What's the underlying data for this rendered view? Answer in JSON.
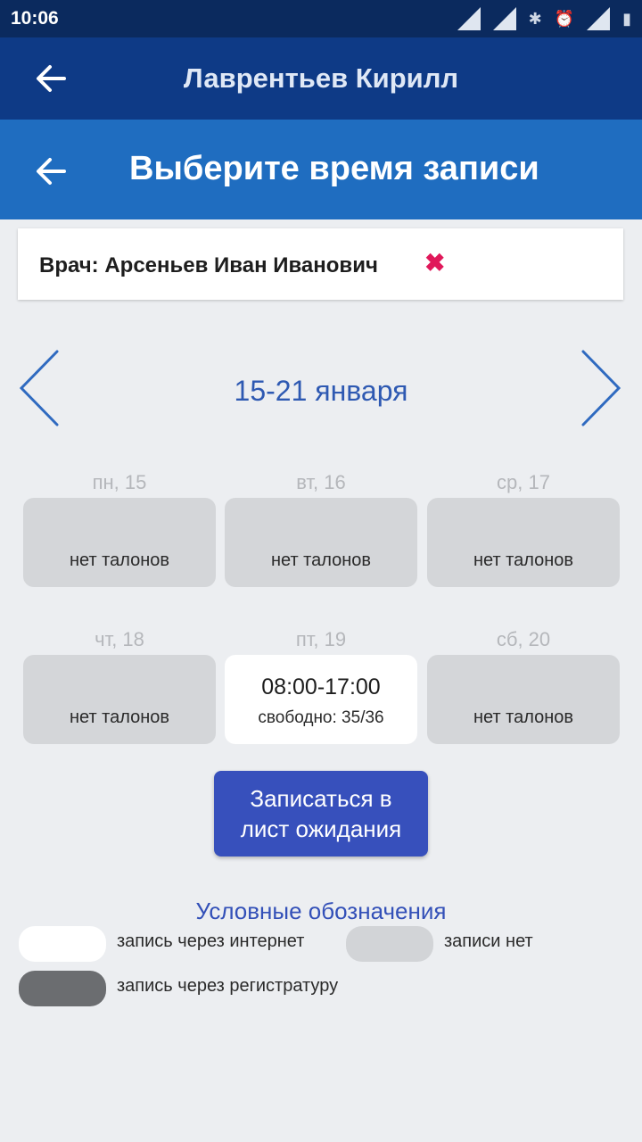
{
  "status_bar": {
    "time": "10:06"
  },
  "header": {
    "patient_name": "Лаврентьев Кирилл"
  },
  "subheader": {
    "title": "Выберите время записи"
  },
  "doctor": {
    "label": "Врач: Арсеньев Иван Иванович",
    "remove_glyph": "✖"
  },
  "week": {
    "label": "15-21 января"
  },
  "days": [
    {
      "label": "пн, 15",
      "status": "нет талонов"
    },
    {
      "label": "вт, 16",
      "status": "нет талонов"
    },
    {
      "label": "ср, 17",
      "status": "нет талонов"
    },
    {
      "label": "чт, 18",
      "status": "нет талонов"
    },
    {
      "label": "пт, 19",
      "time": "08:00-17:00",
      "free": "свободно: 35/36"
    },
    {
      "label": "сб, 20",
      "status": "нет талонов"
    }
  ],
  "waitlist_button": {
    "label": "Записаться в лист ожидания"
  },
  "legend": {
    "title": "Условные обозначения",
    "items": [
      {
        "text": "запись через интернет",
        "color": "#ffffff"
      },
      {
        "text": "записи нет",
        "color": "#d2d4d7"
      },
      {
        "text": "запись через регистратуру",
        "color": "#6b6d70"
      }
    ]
  },
  "colors": {
    "header_bg": "#0e3a86",
    "subheader_bg": "#1f6dc0",
    "accent": "#3750bc",
    "remove": "#e0185a"
  },
  "icons": [
    "back-arrow-icon",
    "close-icon",
    "chevron-left-icon",
    "chevron-right-icon"
  ]
}
